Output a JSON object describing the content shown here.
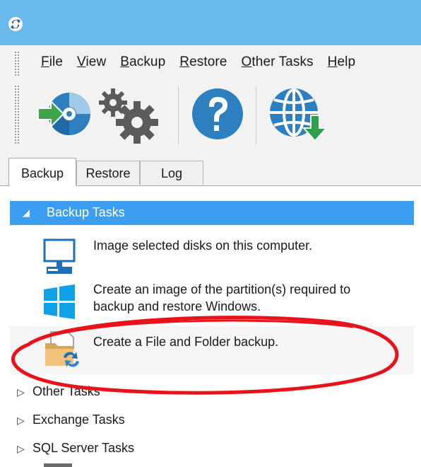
{
  "menu": {
    "file": {
      "mnemonic": "F",
      "rest": "ile"
    },
    "view": {
      "mnemonic": "V",
      "rest": "iew"
    },
    "backup": {
      "mnemonic": "B",
      "rest": "ackup"
    },
    "restore": {
      "mnemonic": "R",
      "rest": "estore"
    },
    "other_tasks": {
      "mnemonic": "O",
      "rest": "ther Tasks"
    },
    "help": {
      "mnemonic": "H",
      "rest": "elp"
    }
  },
  "tabs": [
    "Backup",
    "Restore",
    "Log"
  ],
  "section": {
    "title": "Backup Tasks"
  },
  "tasks": [
    "Image selected disks on this computer.",
    "Create an image of the partition(s) required to",
    "backup and restore Windows.",
    "Create a File and Folder backup."
  ],
  "tree": [
    "Other Tasks",
    "Exchange Tasks",
    "SQL Server Tasks"
  ],
  "colors": {
    "titlebar": "#68b9ec",
    "selection": "#3c9ef1",
    "highlight_ellipse": "#e8121b"
  }
}
